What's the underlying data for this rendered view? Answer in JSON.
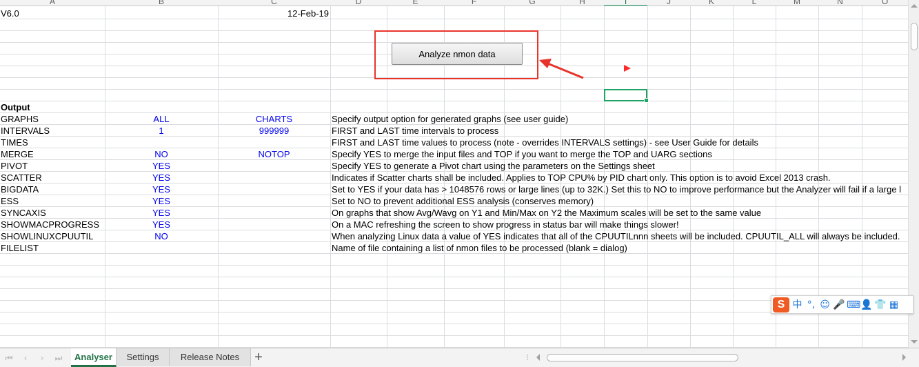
{
  "columns": [
    "A",
    "B",
    "C",
    "D",
    "E",
    "F",
    "G",
    "H",
    "I",
    "J",
    "K",
    "L",
    "M",
    "N",
    "O"
  ],
  "active_column": "I",
  "header_cells": {
    "version": "V6.0",
    "date": "12-Feb-19"
  },
  "button": {
    "label": "Analyze nmon data"
  },
  "section_label": "Output",
  "rows": [
    {
      "name": "GRAPHS",
      "b": "ALL",
      "c": "CHARTS",
      "desc": "Specify output option for generated graphs (see user guide)"
    },
    {
      "name": "INTERVALS",
      "b": "1",
      "c": "999999",
      "desc": "FIRST and LAST time intervals to process"
    },
    {
      "name": "TIMES",
      "b": "",
      "c": "",
      "desc": "FIRST and LAST time values to process (note - overrides INTERVALS settings) - see User Guide for details"
    },
    {
      "name": "MERGE",
      "b": "NO",
      "c": "NOTOP",
      "desc": "Specify YES to merge the input files and TOP if you want to merge the TOP and UARG sections"
    },
    {
      "name": "PIVOT",
      "b": "YES",
      "c": "",
      "desc": "Specify YES to generate a Pivot chart using the parameters on the Settings sheet"
    },
    {
      "name": "SCATTER",
      "b": "YES",
      "c": "",
      "desc": "Indicates if Scatter charts shall be included.  Applies to TOP CPU% by PID chart only.  This option is to avoid Excel 2013 crash."
    },
    {
      "name": "BIGDATA",
      "b": "YES",
      "c": "",
      "desc": "Set to YES if your data has > 1048576 rows or large lines (up to 32K.)  Set this to NO to improve performance but the Analyzer will fail if a large l"
    },
    {
      "name": "ESS",
      "b": "YES",
      "c": "",
      "desc": "Set to NO to prevent additional ESS analysis (conserves memory)"
    },
    {
      "name": "SYNCAXIS",
      "b": "YES",
      "c": "",
      "desc": "On graphs that show Avg/Wavg on Y1 and Min/Max on Y2 the Maximum scales will be set to the same value"
    },
    {
      "name": "SHOWMACPROGRESS",
      "b": "YES",
      "c": "",
      "desc": "On a MAC refreshing the screen to show progress in status bar will make things slower!"
    },
    {
      "name": "SHOWLINUXCPUUTIL",
      "b": "NO",
      "c": "",
      "desc": "When analyzing Linux data a value of YES indicates that all of the CPUUTILnnn sheets will be included.  CPUUTIL_ALL will always be included."
    },
    {
      "name": "FILELIST",
      "b": "",
      "c": "",
      "desc": "Name of file containing a list of nmon files to be processed (blank = dialog)"
    }
  ],
  "tabs": [
    "Analyser",
    "Settings",
    "Release Notes"
  ],
  "active_tab": "Analyser",
  "ime": {
    "logo": "S",
    "lang": "中",
    "punct": "°,",
    "emoji": "☺",
    "voice": "🎤",
    "keyboard": "⌨",
    "user": "👤",
    "skin": "👕",
    "grid": "▦"
  },
  "colors": {
    "accent": "#217346",
    "selection": "#21a366",
    "annotation": "#e8332b",
    "value_blue": "#0000ee"
  }
}
